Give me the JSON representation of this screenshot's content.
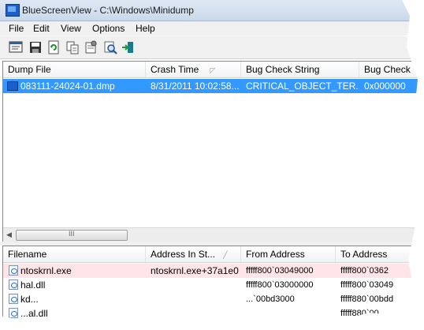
{
  "window": {
    "title": "BlueScreenView  -  C:\\Windows\\Minidump"
  },
  "menu": {
    "items": [
      "File",
      "Edit",
      "View",
      "Options",
      "Help"
    ]
  },
  "toolbar": {
    "icons": [
      "html-report-icon",
      "save-icon",
      "refresh-icon",
      "copy-icon",
      "properties-icon",
      "find-icon",
      "exit-icon"
    ]
  },
  "dumps": {
    "columns": [
      "Dump File",
      "Crash Time",
      "Bug Check String",
      "Bug Check"
    ],
    "rows": [
      {
        "dump_file": "083111-24024-01.dmp",
        "crash_time": "8/31/2011 10:02:58...",
        "bug_check_string": "CRITICAL_OBJECT_TER...",
        "bug_check": "0x000000"
      }
    ],
    "scroll_grip": "III"
  },
  "modules": {
    "columns": [
      "Filename",
      "Address In St...",
      "From Address",
      "To Address"
    ],
    "rows": [
      {
        "filename": "ntoskrnl.exe",
        "address_in_stack": "ntoskrnl.exe+37a1e0",
        "from": "fffff800`03049000",
        "to": "fffff800`0362"
      },
      {
        "filename": "hal.dll",
        "address_in_stack": "",
        "from": "fffff800`03000000",
        "to": "fffff800`03049"
      },
      {
        "filename": "kd...",
        "address_in_stack": "",
        "from": "...`00bd3000",
        "to": "fffff880`00bdd"
      },
      {
        "filename": "...al.dll",
        "address_in_stack": "",
        "from": "...",
        "to": "fffff880`00..."
      }
    ]
  },
  "colors": {
    "selection": "#3399ff",
    "highlight_row": "#ffe4e8"
  }
}
